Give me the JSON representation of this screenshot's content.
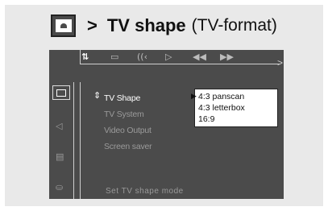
{
  "heading": {
    "arrow": ">",
    "title": "TV shape",
    "subtitle": "(TV-format)",
    "icon": "screen-icon"
  },
  "topbar": {
    "icons": [
      {
        "name": "settings-icon",
        "glyph": "⇅",
        "active": true
      },
      {
        "name": "subtitle-icon",
        "glyph": "▭",
        "active": false
      },
      {
        "name": "audio-icon",
        "glyph": "((‹",
        "active": false
      },
      {
        "name": "play-icon",
        "glyph": "▷",
        "active": false
      },
      {
        "name": "rewind-icon",
        "glyph": "◀◀",
        "active": false
      },
      {
        "name": "forward-icon",
        "glyph": "▶▶",
        "active": false
      }
    ],
    "end_arrow": ">"
  },
  "sidebar": {
    "items": [
      {
        "name": "picture-setup-icon",
        "glyph": "▣",
        "selected": true
      },
      {
        "name": "sound-setup-icon",
        "glyph": "◁",
        "selected": false
      },
      {
        "name": "language-setup-icon",
        "glyph": "▤",
        "selected": false
      },
      {
        "name": "features-setup-icon",
        "glyph": "⛀",
        "selected": false
      }
    ]
  },
  "menu": {
    "cursor": "⇕",
    "items": [
      "TV Shape",
      "TV System",
      "Video Output",
      "Screen saver"
    ],
    "active_index": 0
  },
  "options": {
    "pointer": "▶",
    "items": [
      "4:3 panscan",
      "4:3 letterbox",
      "16:9"
    ],
    "selected_index": 0
  },
  "status": {
    "text": "Set TV shape mode"
  },
  "colors": {
    "screen_bg": "#4b4b4b",
    "frame_bg": "#e9e9e9",
    "active_text": "#ffffff",
    "inactive_text": "#9a9a9a"
  }
}
